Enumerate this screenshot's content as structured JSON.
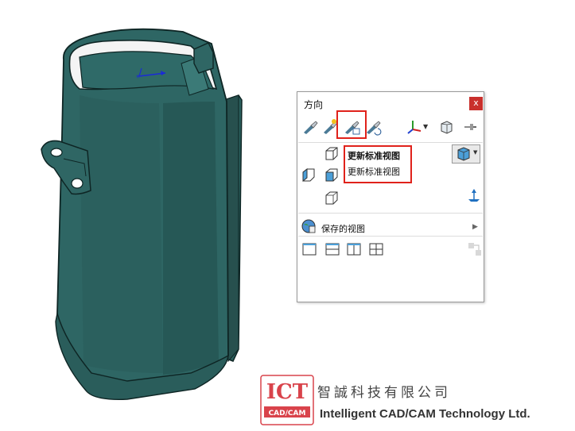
{
  "dialog": {
    "title": "方向",
    "close_glyph": "x",
    "toolbar": [
      {
        "icon": "view-orientation-icon"
      },
      {
        "icon": "new-view-icon"
      },
      {
        "icon": "update-standard-views-icon",
        "highlighted": true
      },
      {
        "icon": "reset-standard-views-icon"
      },
      {
        "icon": "view-selector-axis-icon"
      },
      {
        "icon": "dropdown-arrow-icon"
      },
      {
        "icon": "view-cube-icon"
      },
      {
        "icon": "pin-icon"
      }
    ],
    "context_menu": {
      "items": [
        "更新标准视图",
        "更新标准视图"
      ]
    },
    "saved_views_label": "保存的视图",
    "layout_buttons": [
      "single-view-icon",
      "two-view-horizontal-icon",
      "two-view-vertical-icon",
      "four-view-icon"
    ],
    "accent_red": "#e0221b",
    "model_color": "#2c5f5d"
  },
  "watermark": {
    "logo_top": "ICT",
    "logo_bottom": "CAD/CAM",
    "company_cn": "智誠科技有限公司",
    "company_en": "Intelligent CAD/CAM Technology Ltd."
  }
}
